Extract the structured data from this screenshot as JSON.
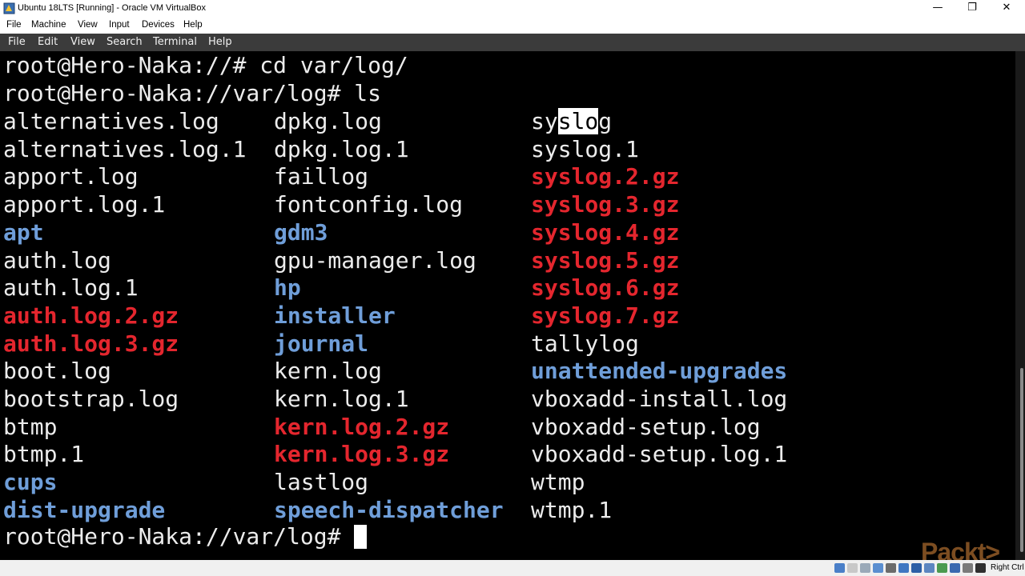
{
  "window": {
    "title": "Ubuntu 18LTS [Running] - Oracle VM VirtualBox",
    "controls": {
      "minimize": "—",
      "restore": "❐",
      "close": "✕"
    }
  },
  "vbox_menu": [
    "File",
    "Machine",
    "View",
    "Input",
    "Devices",
    "Help"
  ],
  "terminal_menu": [
    "File",
    "Edit",
    "View",
    "Search",
    "Terminal",
    "Help"
  ],
  "terminal": {
    "prompt1": "root@Hero-Naka://# cd var/log/",
    "prompt2": "root@Hero-Naka://var/log# ls",
    "prompt_final": "root@Hero-Naka://var/log# ",
    "col1": [
      {
        "name": "alternatives.log",
        "type": "file"
      },
      {
        "name": "alternatives.log.1",
        "type": "file"
      },
      {
        "name": "apport.log",
        "type": "file"
      },
      {
        "name": "apport.log.1",
        "type": "file"
      },
      {
        "name": "apt",
        "type": "dir"
      },
      {
        "name": "auth.log",
        "type": "file"
      },
      {
        "name": "auth.log.1",
        "type": "file"
      },
      {
        "name": "auth.log.2.gz",
        "type": "archive"
      },
      {
        "name": "auth.log.3.gz",
        "type": "archive"
      },
      {
        "name": "boot.log",
        "type": "file"
      },
      {
        "name": "bootstrap.log",
        "type": "file"
      },
      {
        "name": "btmp",
        "type": "file"
      },
      {
        "name": "btmp.1",
        "type": "file"
      },
      {
        "name": "cups",
        "type": "dir"
      },
      {
        "name": "dist-upgrade",
        "type": "dir"
      }
    ],
    "col2": [
      {
        "name": "dpkg.log",
        "type": "file"
      },
      {
        "name": "dpkg.log.1",
        "type": "file"
      },
      {
        "name": "faillog",
        "type": "file"
      },
      {
        "name": "fontconfig.log",
        "type": "file"
      },
      {
        "name": "gdm3",
        "type": "dir"
      },
      {
        "name": "gpu-manager.log",
        "type": "file"
      },
      {
        "name": "hp",
        "type": "dir"
      },
      {
        "name": "installer",
        "type": "dir"
      },
      {
        "name": "journal",
        "type": "dir"
      },
      {
        "name": "kern.log",
        "type": "file"
      },
      {
        "name": "kern.log.1",
        "type": "file"
      },
      {
        "name": "kern.log.2.gz",
        "type": "archive"
      },
      {
        "name": "kern.log.3.gz",
        "type": "archive"
      },
      {
        "name": "lastlog",
        "type": "file"
      },
      {
        "name": "speech-dispatcher",
        "type": "dir"
      }
    ],
    "col3": [
      {
        "name": "syslog",
        "type": "file"
      },
      {
        "name": "syslog.1",
        "type": "file"
      },
      {
        "name": "syslog.2.gz",
        "type": "archive"
      },
      {
        "name": "syslog.3.gz",
        "type": "archive"
      },
      {
        "name": "syslog.4.gz",
        "type": "archive"
      },
      {
        "name": "syslog.5.gz",
        "type": "archive"
      },
      {
        "name": "syslog.6.gz",
        "type": "archive"
      },
      {
        "name": "syslog.7.gz",
        "type": "archive"
      },
      {
        "name": "tallylog",
        "type": "file"
      },
      {
        "name": "unattended-upgrades",
        "type": "dir"
      },
      {
        "name": "vboxadd-install.log",
        "type": "file"
      },
      {
        "name": "vboxadd-setup.log",
        "type": "file"
      },
      {
        "name": "vboxadd-setup.log.1",
        "type": "file"
      },
      {
        "name": "wtmp",
        "type": "file"
      },
      {
        "name": "wtmp.1",
        "type": "file"
      }
    ],
    "selection": {
      "text": "slo"
    }
  },
  "status": {
    "host_key": "Right Ctrl"
  },
  "watermark": "Packt>",
  "colors": {
    "terminal_bg": "#000000",
    "text": "#ececec",
    "directory": "#6f9ed9",
    "archive": "#e4262e",
    "terminal_menubar": "#3b3b3b"
  }
}
